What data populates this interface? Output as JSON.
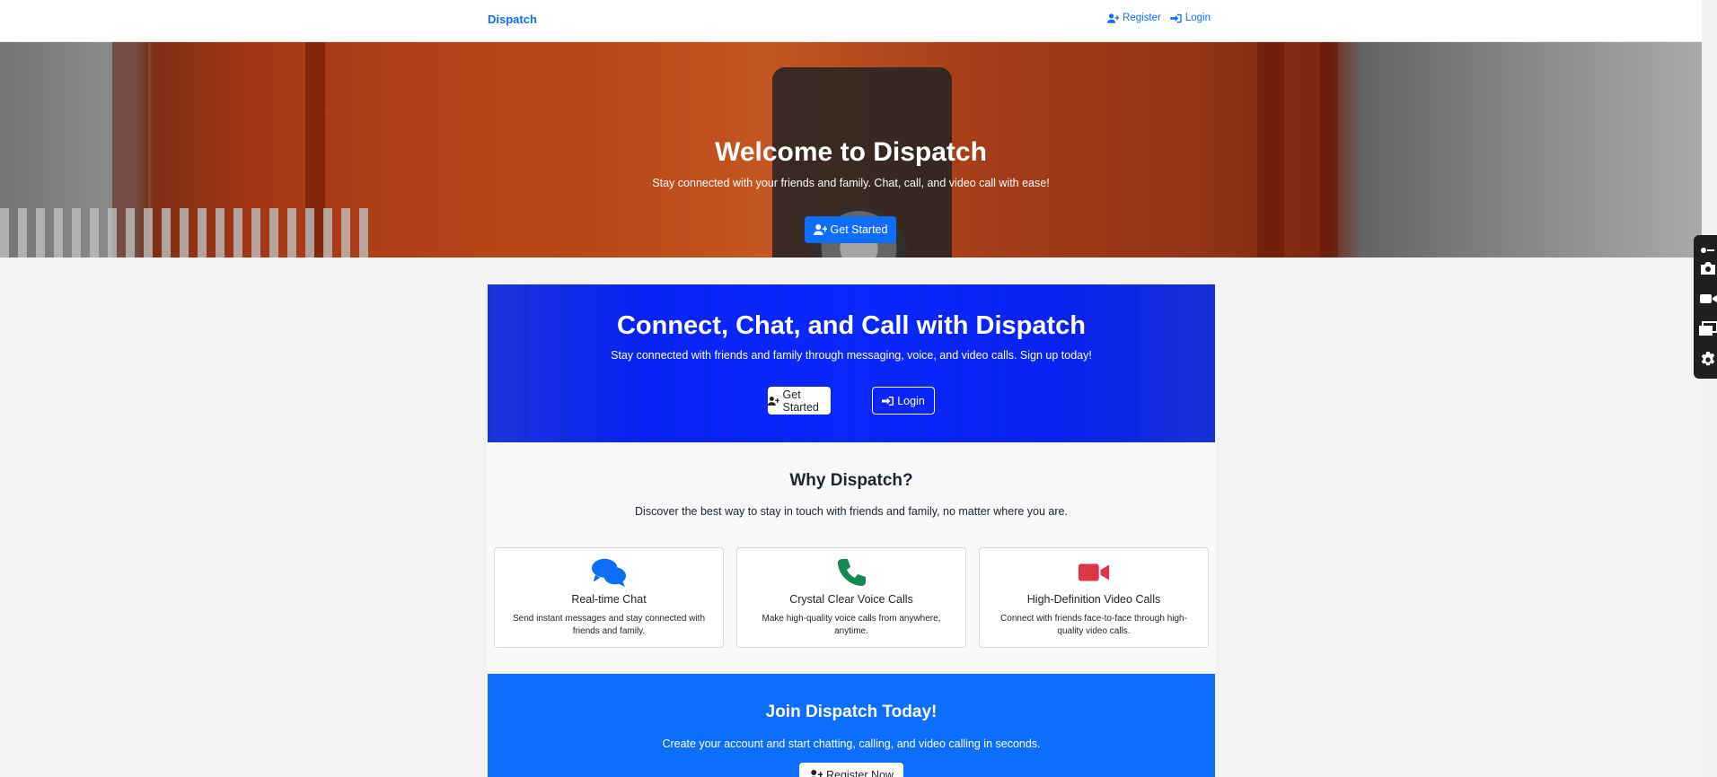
{
  "navbar": {
    "brand": "Dispatch",
    "register_label": "Register",
    "login_label": "Login"
  },
  "hero": {
    "title": "Welcome to Dispatch",
    "subtitle": "Stay connected with your friends and family. Chat, call, and video call with ease!",
    "cta_label": "Get Started"
  },
  "cta": {
    "title": "Connect, Chat, and Call with Dispatch",
    "subtitle": "Stay connected with friends and family through messaging, voice, and video calls. Sign up today!",
    "get_started_label": "Get Started",
    "login_label": "Login"
  },
  "why": {
    "title": "Why Dispatch?",
    "subtitle": "Discover the best way to stay in touch with friends and family, no matter where you are.",
    "cards": [
      {
        "icon": "chat-bubbles-icon",
        "color": "#0d6efd",
        "title": "Real-time Chat",
        "text": "Send instant messages and stay connected with friends and family."
      },
      {
        "icon": "phone-icon",
        "color": "#198754",
        "title": "Crystal Clear Voice Calls",
        "text": "Make high-quality voice calls from anywhere, anytime."
      },
      {
        "icon": "video-camera-icon",
        "color": "#dc3545",
        "title": "High-Definition Video Calls",
        "text": "Connect with friends face-to-face through high-quality video calls."
      }
    ]
  },
  "join": {
    "title": "Join Dispatch Today!",
    "subtitle": "Create your account and start chatting, calling, and video calling in seconds.",
    "register_label": "Register Now"
  },
  "colors": {
    "primary": "#0d6efd",
    "cta_blue": "#0a27ff",
    "success": "#198754",
    "danger": "#dc3545"
  }
}
